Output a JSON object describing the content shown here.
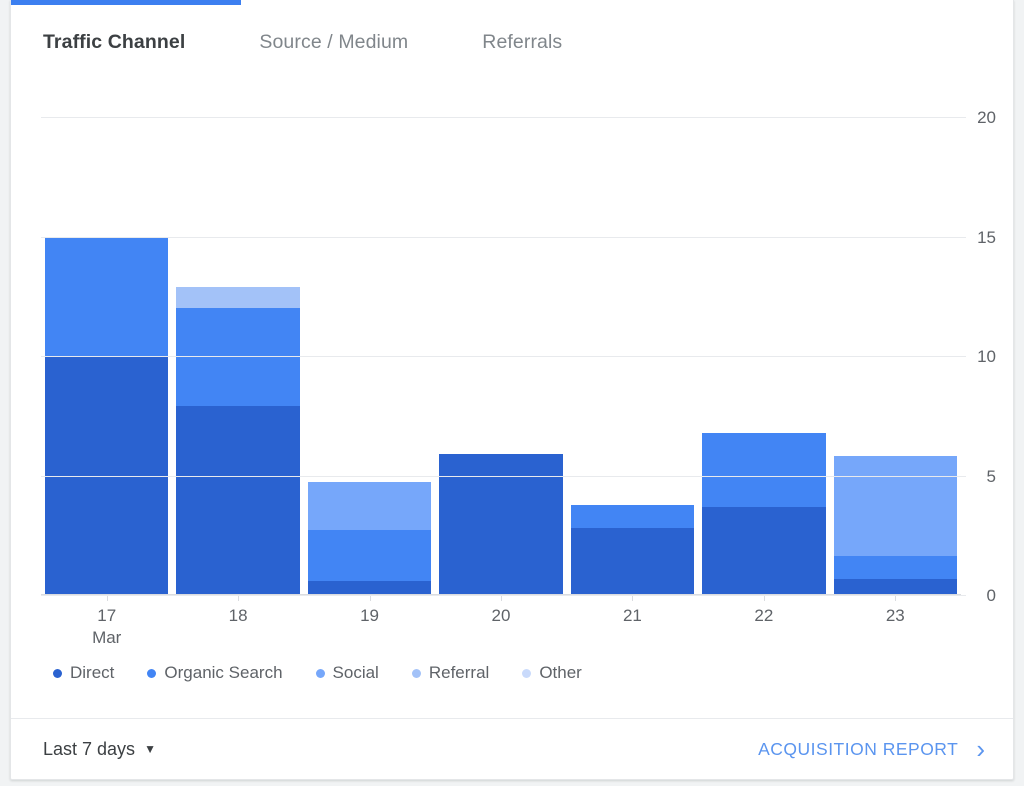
{
  "card": {
    "accent_color": "#3c7ff0"
  },
  "tabs": [
    {
      "label": "Traffic Channel",
      "active": true
    },
    {
      "label": "Source / Medium",
      "active": false
    },
    {
      "label": "Referrals",
      "active": false
    }
  ],
  "footer": {
    "date_range_label": "Last 7 days",
    "caret_icon": "chevron-down-icon",
    "report_link_label": "Acquisition Report",
    "report_link_icon": "chevron-right-icon",
    "link_color": "#5b95ef"
  },
  "chart_data": {
    "type": "bar",
    "stacked": true,
    "title": "",
    "xlabel": "",
    "ylabel": "",
    "grid": true,
    "legend_position": "bottom",
    "ylim": [
      0,
      20
    ],
    "yticks": [
      0,
      5,
      10,
      15,
      20
    ],
    "categories": [
      "17",
      "18",
      "19",
      "20",
      "21",
      "22",
      "23"
    ],
    "category_sublabels": [
      "Mar",
      "",
      "",
      "",
      "",
      "",
      ""
    ],
    "series": [
      {
        "name": "Direct",
        "color": "#2a62d0",
        "values": [
          10.0,
          7.9,
          0.6,
          5.9,
          2.8,
          3.7,
          0.65
        ]
      },
      {
        "name": "Organic Search",
        "color": "#4285f4",
        "values": [
          5.0,
          4.1,
          2.1,
          0.0,
          0.95,
          3.1,
          1.0
        ]
      },
      {
        "name": "Social",
        "color": "#76a7fa",
        "values": [
          0.0,
          0.0,
          2.05,
          0.0,
          0.0,
          0.0,
          4.15
        ]
      },
      {
        "name": "Referral",
        "color": "#a3c2f8",
        "values": [
          0.0,
          0.9,
          0.0,
          0.0,
          0.0,
          0.0,
          0.0
        ]
      },
      {
        "name": "Other",
        "color": "#c9dafb",
        "values": [
          0.0,
          0.0,
          0.0,
          0.0,
          0.0,
          0.0,
          0.0
        ]
      }
    ],
    "totals": [
      15.0,
      12.9,
      4.75,
      5.9,
      3.75,
      6.8,
      5.8
    ]
  }
}
